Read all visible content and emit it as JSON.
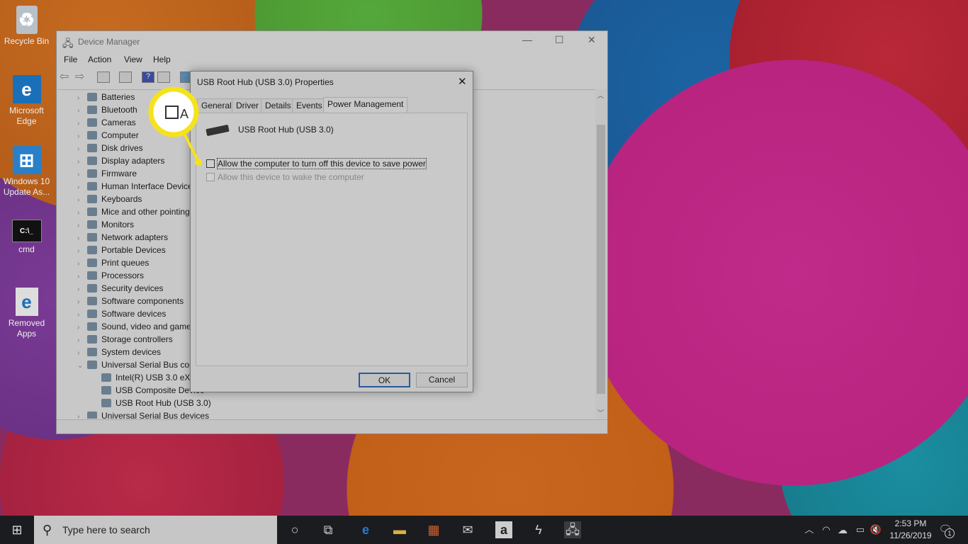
{
  "desktop": {
    "icons": [
      "Recycle Bin",
      "Microsoft Edge",
      "Windows 10 Update As...",
      "cmd",
      "Removed Apps"
    ]
  },
  "device_manager": {
    "title": "Device Manager",
    "menu": [
      "File",
      "Action",
      "View",
      "Help"
    ],
    "tree": [
      {
        "label": "Batteries",
        "expanded": false
      },
      {
        "label": "Bluetooth",
        "expanded": false
      },
      {
        "label": "Cameras",
        "expanded": false
      },
      {
        "label": "Computer",
        "expanded": false
      },
      {
        "label": "Disk drives",
        "expanded": false
      },
      {
        "label": "Display adapters",
        "expanded": false
      },
      {
        "label": "Firmware",
        "expanded": false
      },
      {
        "label": "Human Interface Devices",
        "expanded": false
      },
      {
        "label": "Keyboards",
        "expanded": false
      },
      {
        "label": "Mice and other pointing devices",
        "expanded": false
      },
      {
        "label": "Monitors",
        "expanded": false
      },
      {
        "label": "Network adapters",
        "expanded": false
      },
      {
        "label": "Portable Devices",
        "expanded": false
      },
      {
        "label": "Print queues",
        "expanded": false
      },
      {
        "label": "Processors",
        "expanded": false
      },
      {
        "label": "Security devices",
        "expanded": false
      },
      {
        "label": "Software components",
        "expanded": false
      },
      {
        "label": "Software devices",
        "expanded": false
      },
      {
        "label": "Sound, video and game controllers",
        "expanded": false
      },
      {
        "label": "Storage controllers",
        "expanded": false
      },
      {
        "label": "System devices",
        "expanded": false
      },
      {
        "label": "Universal Serial Bus controllers",
        "expanded": true
      },
      {
        "label": "Intel(R) USB 3.0 eXtensible Host Controller",
        "child": true
      },
      {
        "label": "USB Composite Device",
        "child": true
      },
      {
        "label": "USB Root Hub (USB 3.0)",
        "child": true
      },
      {
        "label": "Universal Serial Bus devices",
        "expanded": false
      }
    ]
  },
  "dialog": {
    "title": "USB Root Hub (USB 3.0) Properties",
    "tabs": [
      "General",
      "Driver",
      "Details",
      "Events",
      "Power Management"
    ],
    "active_tab": "Power Management",
    "device_name": "USB Root Hub (USB 3.0)",
    "option_turn_off": {
      "label": "Allow the computer to turn off this device to save power",
      "checked": false
    },
    "option_wake": {
      "label": "Allow this device to wake the computer",
      "checked": false,
      "disabled": true
    },
    "ok": "OK",
    "cancel": "Cancel"
  },
  "callout": {
    "color": "#f5e31a"
  },
  "taskbar": {
    "search_placeholder": "Type here to search",
    "time": "2:53 PM",
    "date": "11/26/2019",
    "notifications": "1"
  }
}
